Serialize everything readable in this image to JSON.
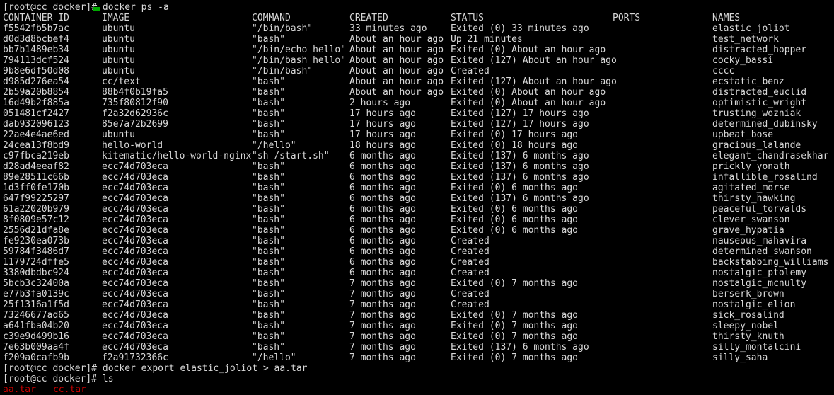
{
  "terminal": {
    "colors": {
      "background": "#000000",
      "foreground": "#d8d8d8",
      "file_red": "#cc0000",
      "cursor_green": "#00aa00"
    },
    "prompt": "[root@cc docker]# ",
    "commands": {
      "ps": "docker ps -a",
      "export": "docker export elastic_joliot > aa.tar",
      "ls": "ls"
    },
    "ls_output": {
      "file1": "aa.tar",
      "file2": "cc.tar"
    }
  },
  "table": {
    "headers": {
      "container_id": "CONTAINER ID",
      "image": "IMAGE",
      "command": "COMMAND",
      "created": "CREATED",
      "status": "STATUS",
      "ports": "PORTS",
      "names": "NAMES"
    },
    "rows": [
      {
        "id": "f5542fb5b7ac",
        "image": "ubuntu",
        "command": "\"/bin/bash\"",
        "created": "33 minutes ago",
        "status": "Exited (0) 33 minutes ago",
        "ports": "",
        "names": "elastic_joliot"
      },
      {
        "id": "d0d3d8bcbef4",
        "image": "ubuntu",
        "command": "\"bash\"",
        "created": "About an hour ago",
        "status": "Up 21 minutes",
        "ports": "",
        "names": "test_network"
      },
      {
        "id": "bb7b1489eb34",
        "image": "ubuntu",
        "command": "\"/bin/echo hello\"",
        "created": "About an hour ago",
        "status": "Exited (0) About an hour ago",
        "ports": "",
        "names": "distracted_hopper"
      },
      {
        "id": "794113dcf524",
        "image": "ubuntu",
        "command": "\"/bin/bash hello\"",
        "created": "About an hour ago",
        "status": "Exited (127) About an hour ago",
        "ports": "",
        "names": "cocky_bassi"
      },
      {
        "id": "9b8e6df50d08",
        "image": "ubuntu",
        "command": "\"/bin/bash\"",
        "created": "About an hour ago",
        "status": "Created",
        "ports": "",
        "names": "cccc"
      },
      {
        "id": "d985d276ea54",
        "image": "cc/text",
        "command": "\"bash\"",
        "created": "About an hour ago",
        "status": "Exited (127) About an hour ago",
        "ports": "",
        "names": "ecstatic_benz"
      },
      {
        "id": "2b59a20b8854",
        "image": "88b4f0b19fa5",
        "command": "\"bash\"",
        "created": "About an hour ago",
        "status": "Exited (0) About an hour ago",
        "ports": "",
        "names": "distracted_euclid"
      },
      {
        "id": "16d49b2f885a",
        "image": "735f80812f90",
        "command": "\"bash\"",
        "created": "2 hours ago",
        "status": "Exited (0) About an hour ago",
        "ports": "",
        "names": "optimistic_wright"
      },
      {
        "id": "051481cf2427",
        "image": "f2a32d62936c",
        "command": "\"bash\"",
        "created": "17 hours ago",
        "status": "Exited (127) 17 hours ago",
        "ports": "",
        "names": "trusting_wozniak"
      },
      {
        "id": "dab932096123",
        "image": "85e7a72b2699",
        "command": "\"bash\"",
        "created": "17 hours ago",
        "status": "Exited (127) 17 hours ago",
        "ports": "",
        "names": "determined_dubinsky"
      },
      {
        "id": "22ae4e4ae6ed",
        "image": "ubuntu",
        "command": "\"bash\"",
        "created": "17 hours ago",
        "status": "Exited (0) 17 hours ago",
        "ports": "",
        "names": "upbeat_bose"
      },
      {
        "id": "24cea13f8bd9",
        "image": "hello-world",
        "command": "\"/hello\"",
        "created": "18 hours ago",
        "status": "Exited (0) 18 hours ago",
        "ports": "",
        "names": "gracious_lalande"
      },
      {
        "id": "c97fbca219eb",
        "image": "kitematic/hello-world-nginx",
        "command": "\"sh /start.sh\"",
        "created": "6 months ago",
        "status": "Exited (137) 6 months ago",
        "ports": "",
        "names": "elegant_chandrasekhar"
      },
      {
        "id": "d28ad4eeaf82",
        "image": "ecc74d703eca",
        "command": "\"bash\"",
        "created": "6 months ago",
        "status": "Exited (137) 6 months ago",
        "ports": "",
        "names": "prickly_yonath"
      },
      {
        "id": "89e28511c66b",
        "image": "ecc74d703eca",
        "command": "\"bash\"",
        "created": "6 months ago",
        "status": "Exited (137) 6 months ago",
        "ports": "",
        "names": "infallible_rosalind"
      },
      {
        "id": "1d3ff0fe170b",
        "image": "ecc74d703eca",
        "command": "\"bash\"",
        "created": "6 months ago",
        "status": "Exited (0) 6 months ago",
        "ports": "",
        "names": "agitated_morse"
      },
      {
        "id": "647f99225297",
        "image": "ecc74d703eca",
        "command": "\"bash\"",
        "created": "6 months ago",
        "status": "Exited (137) 6 months ago",
        "ports": "",
        "names": "thirsty_hawking"
      },
      {
        "id": "61a22020b979",
        "image": "ecc74d703eca",
        "command": "\"bash\"",
        "created": "6 months ago",
        "status": "Exited (0) 6 months ago",
        "ports": "",
        "names": "peaceful_torvalds"
      },
      {
        "id": "8f0809e57c12",
        "image": "ecc74d703eca",
        "command": "\"bash\"",
        "created": "6 months ago",
        "status": "Exited (0) 6 months ago",
        "ports": "",
        "names": "clever_swanson"
      },
      {
        "id": "2556d21dfa8e",
        "image": "ecc74d703eca",
        "command": "\"bash\"",
        "created": "6 months ago",
        "status": "Exited (0) 6 months ago",
        "ports": "",
        "names": "grave_hypatia"
      },
      {
        "id": "fe9230ea073b",
        "image": "ecc74d703eca",
        "command": "\"bash\"",
        "created": "6 months ago",
        "status": "Created",
        "ports": "",
        "names": "nauseous_mahavira"
      },
      {
        "id": "59784f3486d7",
        "image": "ecc74d703eca",
        "command": "\"bash\"",
        "created": "6 months ago",
        "status": "Created",
        "ports": "",
        "names": "determined_swanson"
      },
      {
        "id": "1179724dffe5",
        "image": "ecc74d703eca",
        "command": "\"bash\"",
        "created": "6 months ago",
        "status": "Created",
        "ports": "",
        "names": "backstabbing_williams"
      },
      {
        "id": "3380dbdbc924",
        "image": "ecc74d703eca",
        "command": "\"bash\"",
        "created": "6 months ago",
        "status": "Created",
        "ports": "",
        "names": "nostalgic_ptolemy"
      },
      {
        "id": "5bcb3c32400a",
        "image": "ecc74d703eca",
        "command": "\"bash\"",
        "created": "7 months ago",
        "status": "Exited (0) 7 months ago",
        "ports": "",
        "names": "nostalgic_mcnulty"
      },
      {
        "id": "e77b3fa0139c",
        "image": "ecc74d703eca",
        "command": "\"bash\"",
        "created": "7 months ago",
        "status": "Created",
        "ports": "",
        "names": "berserk_brown"
      },
      {
        "id": "25f1316a1f5d",
        "image": "ecc74d703eca",
        "command": "\"bash\"",
        "created": "7 months ago",
        "status": "Created",
        "ports": "",
        "names": "nostalgic_elion"
      },
      {
        "id": "73246677ad65",
        "image": "ecc74d703eca",
        "command": "\"bash\"",
        "created": "7 months ago",
        "status": "Exited (0) 7 months ago",
        "ports": "",
        "names": "sick_rosalind"
      },
      {
        "id": "a641fba04b20",
        "image": "ecc74d703eca",
        "command": "\"bash\"",
        "created": "7 months ago",
        "status": "Exited (0) 7 months ago",
        "ports": "",
        "names": "sleepy_nobel"
      },
      {
        "id": "c39e9d499b16",
        "image": "ecc74d703eca",
        "command": "\"bash\"",
        "created": "7 months ago",
        "status": "Exited (0) 7 months ago",
        "ports": "",
        "names": "thirsty_knuth"
      },
      {
        "id": "7e63b009aa4f",
        "image": "ecc74d703eca",
        "command": "\"bash\"",
        "created": "7 months ago",
        "status": "Exited (137) 6 months ago",
        "ports": "",
        "names": "silly_montalcini"
      },
      {
        "id": "f209a0cafb9b",
        "image": "f2a91732366c",
        "command": "\"/hello\"",
        "created": "7 months ago",
        "status": "Exited (0) 7 months ago",
        "ports": "",
        "names": "silly_saha"
      }
    ]
  }
}
